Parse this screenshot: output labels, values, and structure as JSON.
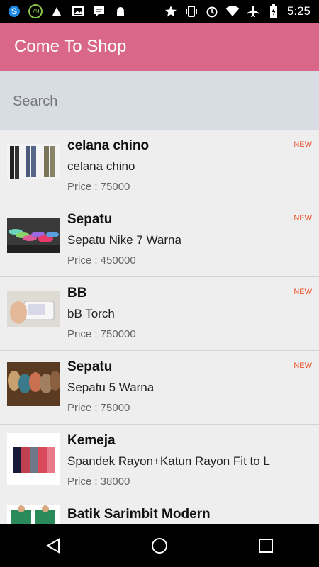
{
  "status_bar": {
    "time": "5:25",
    "badge_number": "79",
    "left_icons": [
      "skype-icon",
      "battery-badge-icon",
      "notification-icon",
      "image-icon",
      "message-icon",
      "android-icon"
    ],
    "right_icons": [
      "star-icon",
      "vibrate-icon",
      "alarm-icon",
      "wifi-icon",
      "airplane-icon",
      "battery-icon"
    ]
  },
  "app_bar": {
    "title": "Come To Shop",
    "color": "#d9678a"
  },
  "search": {
    "placeholder": "Search",
    "value": ""
  },
  "products": [
    {
      "title": "celana chino",
      "subtitle": "celana chino",
      "price": "Price : 75000",
      "badge": "NEW"
    },
    {
      "title": "Sepatu",
      "subtitle": "Sepatu Nike 7 Warna",
      "price": "Price : 450000",
      "badge": "NEW"
    },
    {
      "title": "BB",
      "subtitle": "bB Torch",
      "price": "Price : 750000",
      "badge": "NEW"
    },
    {
      "title": "Sepatu",
      "subtitle": "Sepatu 5 Warna",
      "price": "Price : 75000",
      "badge": "NEW"
    },
    {
      "title": "Kemeja",
      "subtitle": "Spandek Rayon+Katun Rayon Fit to L",
      "price": "Price : 38000",
      "badge": ""
    },
    {
      "title": "Batik Sarimbit Modern",
      "subtitle": "",
      "price": "",
      "badge": ""
    }
  ],
  "nav": {
    "back": "back-icon",
    "home": "home-icon",
    "recents": "recents-icon"
  }
}
